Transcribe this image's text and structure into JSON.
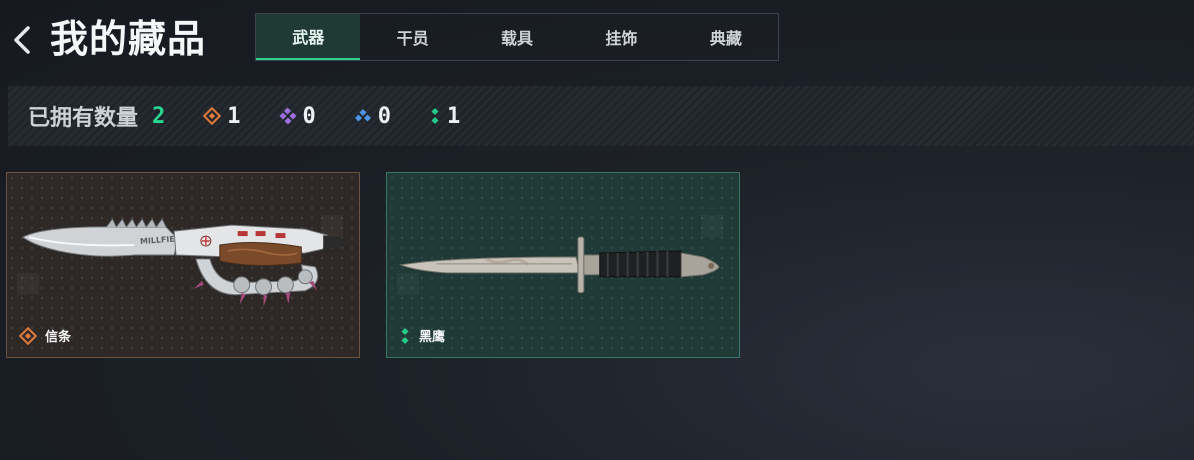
{
  "header": {
    "title": "我的藏品"
  },
  "tabs": [
    {
      "label": "武器",
      "active": true
    },
    {
      "label": "干员",
      "active": false
    },
    {
      "label": "载具",
      "active": false
    },
    {
      "label": "挂饰",
      "active": false
    },
    {
      "label": "典藏",
      "active": false
    }
  ],
  "stats": {
    "label": "已拥有数量",
    "total": "2",
    "rarities": [
      {
        "icon": "orange-diamond-icon",
        "color": "#e07a3a",
        "count": "1"
      },
      {
        "icon": "purple-diamond-icon",
        "color": "#9b6fe0",
        "count": "0"
      },
      {
        "icon": "blue-diamond-icon",
        "color": "#4f93e6",
        "count": "0"
      },
      {
        "icon": "green-diamond-icon",
        "color": "#25c98a",
        "count": "1"
      }
    ]
  },
  "items": [
    {
      "name": "信条",
      "rarity_icon": "orange-diamond-icon",
      "rarity_color": "#e07a3a",
      "blade_engraving": "MILLFIELD"
    },
    {
      "name": "黑鹰",
      "rarity_icon": "green-diamond-icon",
      "rarity_color": "#25c98a"
    }
  ]
}
